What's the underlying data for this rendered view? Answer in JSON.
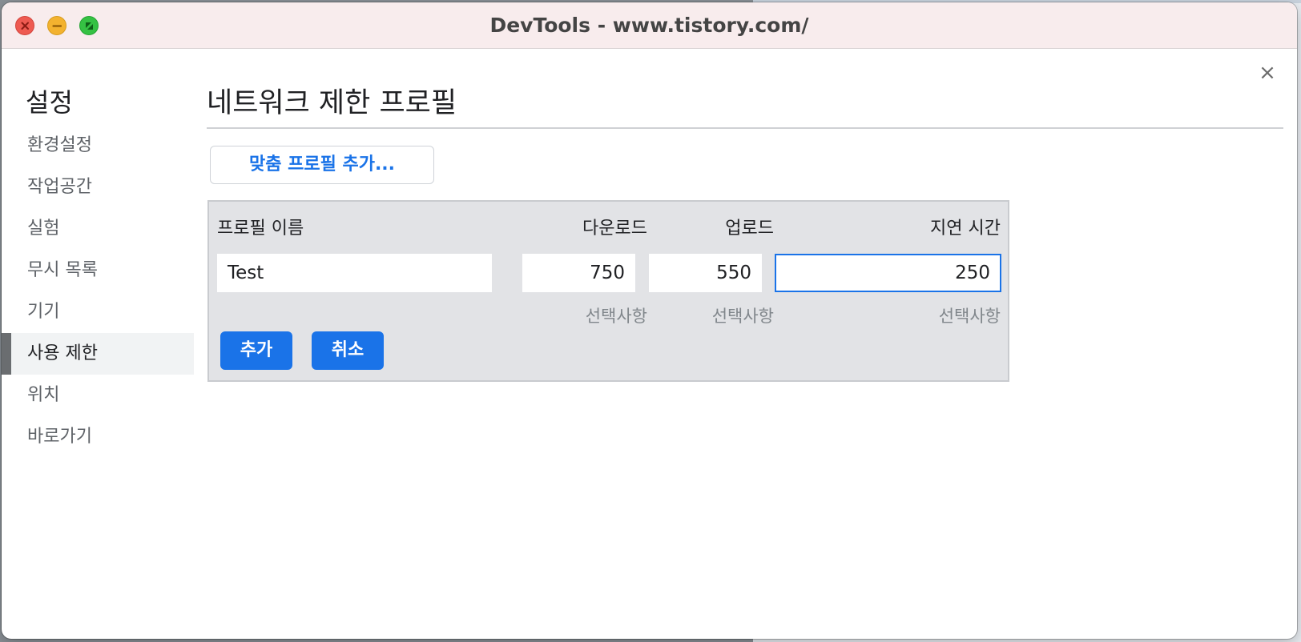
{
  "window": {
    "title": "DevTools - www.tistory.com/"
  },
  "sidebar": {
    "title": "설정",
    "items": [
      {
        "label": "환경설정"
      },
      {
        "label": "작업공간"
      },
      {
        "label": "실험"
      },
      {
        "label": "무시 목록"
      },
      {
        "label": "기기"
      },
      {
        "label": "사용 제한",
        "active": true
      },
      {
        "label": "위치"
      },
      {
        "label": "바로가기"
      }
    ]
  },
  "main": {
    "title": "네트워크 제한 프로필",
    "add_custom_profile_label": "맞춤 프로필 추가...",
    "editor": {
      "headers": {
        "name": "프로필 이름",
        "download": "다운로드",
        "upload": "업로드",
        "latency": "지연 시간"
      },
      "values": {
        "name": "Test",
        "download": "750",
        "upload": "550",
        "latency": "250"
      },
      "hints": {
        "download": "선택사항",
        "upload": "선택사항",
        "latency": "선택사항"
      },
      "add_label": "추가",
      "cancel_label": "취소"
    }
  },
  "close_icon_glyph": "×",
  "colors": {
    "accent": "#1a73e8",
    "titlebar": "#f8eced",
    "editor_bg": "#e2e3e6"
  }
}
